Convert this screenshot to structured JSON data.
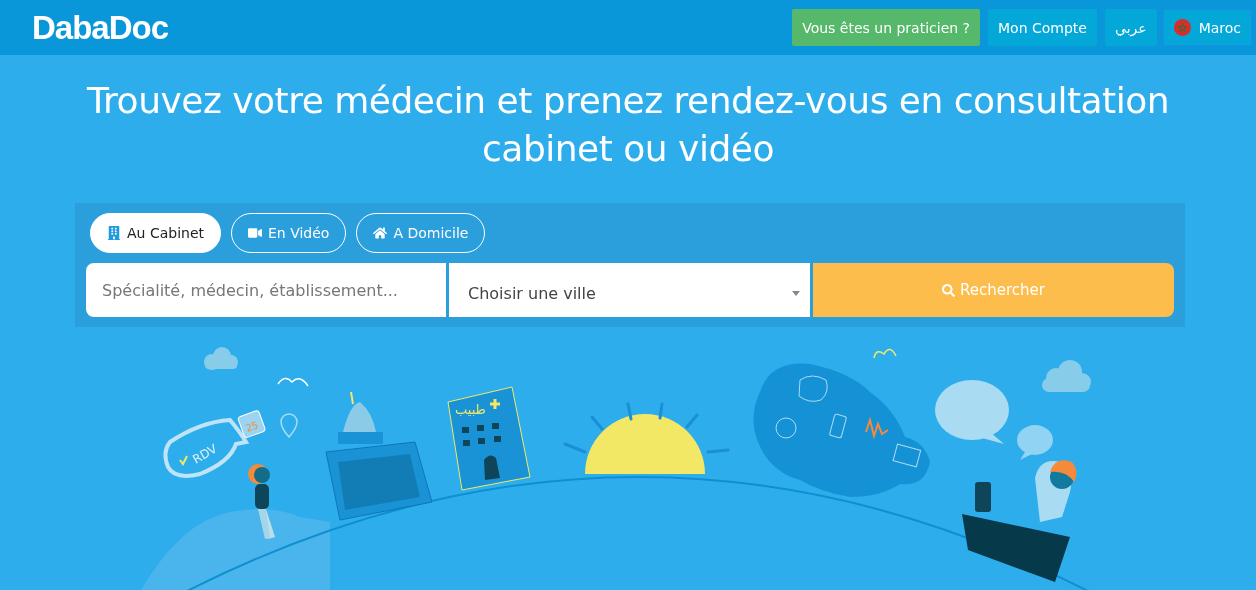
{
  "header": {
    "logo": "DabaDoc",
    "nav": [
      {
        "label": "Vous êtes un praticien ?",
        "kind": "green"
      },
      {
        "label": "Mon Compte",
        "kind": "plain"
      },
      {
        "label": "عربي",
        "kind": "plain"
      },
      {
        "label": "Maroc",
        "kind": "country"
      }
    ]
  },
  "hero": {
    "title": "Trouvez votre médecin et prenez rendez-vous en consultation cabinet ou vidéo"
  },
  "search": {
    "tabs": [
      {
        "label": "Au Cabinet",
        "kind": "cabinet",
        "selected": true
      },
      {
        "label": "En Vidéo",
        "kind": "video",
        "selected": false
      },
      {
        "label": "A Domicile",
        "kind": "home",
        "selected": false
      }
    ],
    "query": {
      "placeholder": "Spécialité, médecin, établissement..."
    },
    "city": {
      "value": "Choisir une ville"
    },
    "button": "Rechercher"
  },
  "illustration": {
    "bubble_label": "RDV",
    "calendar_day": "25",
    "building_sign": "طبيب"
  }
}
